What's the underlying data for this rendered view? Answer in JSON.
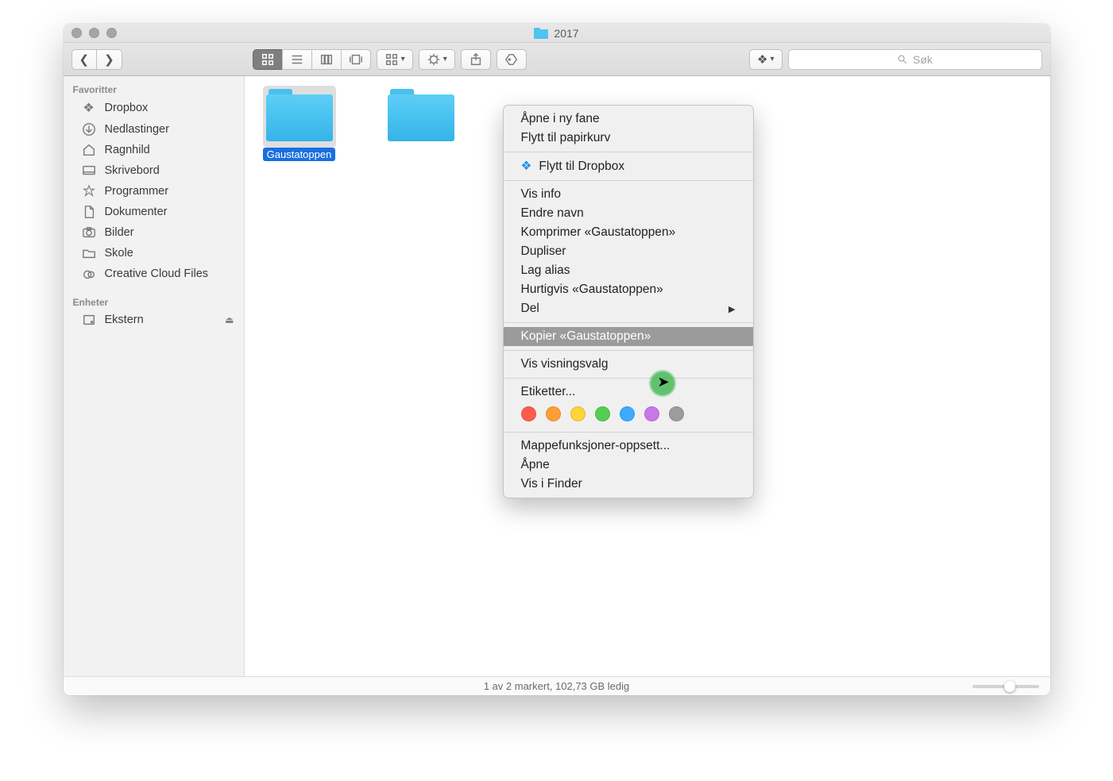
{
  "window": {
    "title": "2017"
  },
  "toolbar": {
    "search_placeholder": "Søk"
  },
  "sidebar": {
    "sections": [
      {
        "title": "Favoritter"
      },
      {
        "title": "Enheter"
      }
    ],
    "favoritter": [
      {
        "label": "Dropbox",
        "icon": "dropbox-icon"
      },
      {
        "label": "Nedlastinger",
        "icon": "download-icon"
      },
      {
        "label": "Ragnhild",
        "icon": "home-icon"
      },
      {
        "label": "Skrivebord",
        "icon": "desktop-icon"
      },
      {
        "label": "Programmer",
        "icon": "applications-icon"
      },
      {
        "label": "Dokumenter",
        "icon": "documents-icon"
      },
      {
        "label": "Bilder",
        "icon": "pictures-icon"
      },
      {
        "label": "Skole",
        "icon": "folder-icon"
      },
      {
        "label": "Creative Cloud Files",
        "icon": "creative-cloud-icon"
      }
    ],
    "enheter": [
      {
        "label": "Ekstern",
        "icon": "disk-icon",
        "ejectable": true
      }
    ]
  },
  "main": {
    "items": [
      {
        "label": "Gaustatoppen",
        "selected": true
      },
      {
        "label": "",
        "selected": false
      }
    ]
  },
  "context_menu": {
    "items": [
      {
        "label": "Åpne i ny fane"
      },
      {
        "label": "Flytt til papirkurv"
      }
    ],
    "dropbox_item": {
      "label": "Flytt til Dropbox"
    },
    "block2": [
      {
        "label": "Vis info"
      },
      {
        "label": "Endre navn"
      },
      {
        "label": "Komprimer «Gaustatoppen»"
      },
      {
        "label": "Dupliser"
      },
      {
        "label": "Lag alias"
      },
      {
        "label": "Hurtigvis «Gaustatoppen»"
      },
      {
        "label": "Del",
        "submenu": true
      }
    ],
    "highlighted": {
      "label": "Kopier «Gaustatoppen»"
    },
    "after_hl": {
      "label": "Vis visningsvalg"
    },
    "tags_label": "Etiketter...",
    "tag_colors": [
      "#ff5b4c",
      "#ff9e37",
      "#ffd43a",
      "#54ce52",
      "#3caaff",
      "#c977e8",
      "#9c9c9c"
    ],
    "bottom": [
      {
        "label": "Mappefunksjoner-oppsett..."
      },
      {
        "label": "Åpne"
      },
      {
        "label": "Vis i Finder"
      }
    ]
  },
  "statusbar": {
    "text": "1 av 2 markert, 102,73 GB ledig"
  }
}
